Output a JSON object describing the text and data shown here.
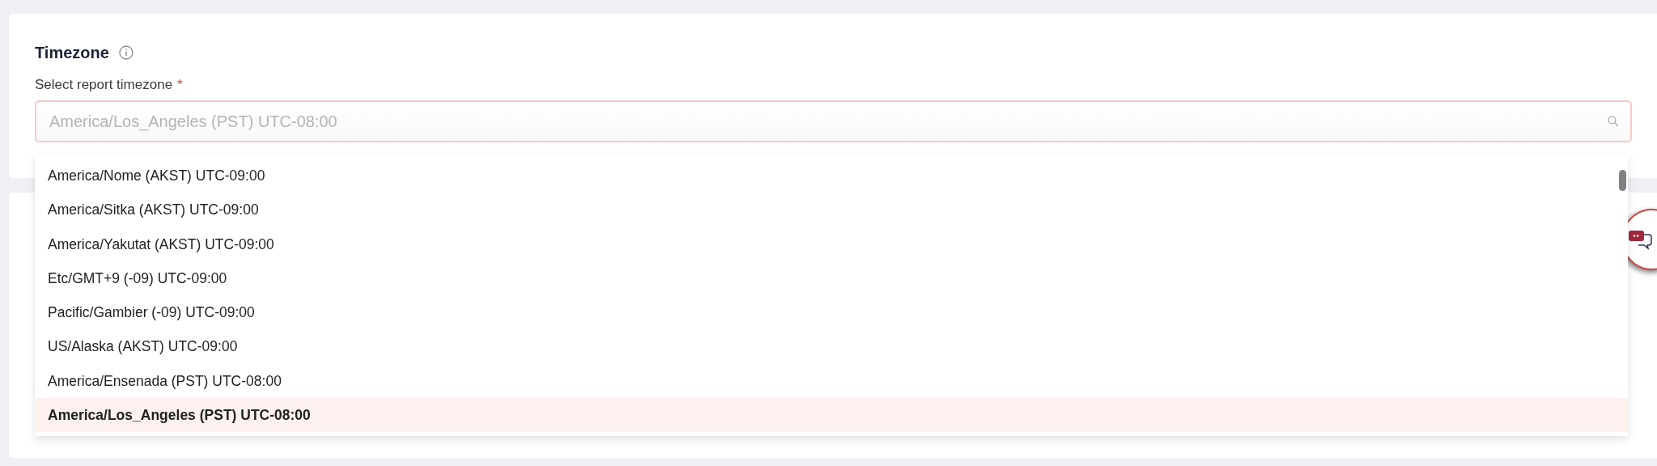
{
  "section": {
    "title": "Timezone"
  },
  "field": {
    "label": "Select report timezone",
    "required_mark": "*",
    "placeholder": "America/Los_Angeles (PST) UTC-08:00",
    "focused": true
  },
  "dropdown": {
    "options": [
      {
        "label": "America/Nome (AKST) UTC-09:00",
        "selected": false
      },
      {
        "label": "America/Sitka (AKST) UTC-09:00",
        "selected": false
      },
      {
        "label": "America/Yakutat (AKST) UTC-09:00",
        "selected": false
      },
      {
        "label": "Etc/GMT+9 (-09) UTC-09:00",
        "selected": false
      },
      {
        "label": "Pacific/Gambier (-09) UTC-09:00",
        "selected": false
      },
      {
        "label": "US/Alaska (AKST) UTC-09:00",
        "selected": false
      },
      {
        "label": "America/Ensenada (PST) UTC-08:00",
        "selected": false
      },
      {
        "label": "America/Los_Angeles (PST) UTC-08:00",
        "selected": true
      }
    ]
  }
}
